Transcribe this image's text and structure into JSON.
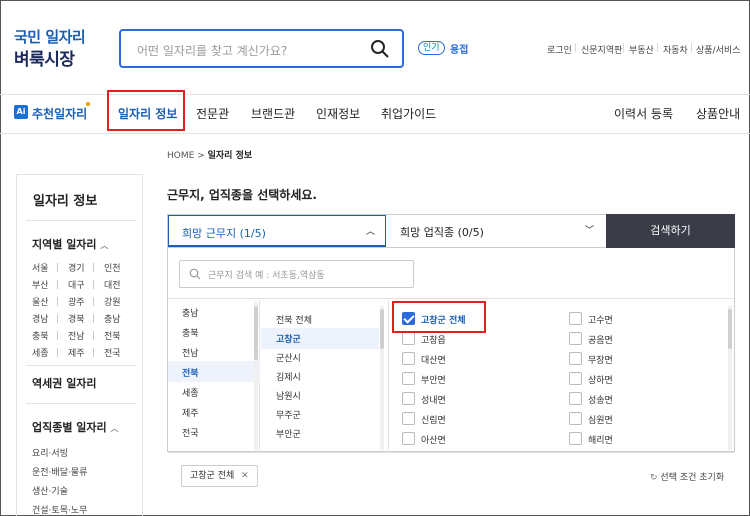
{
  "header": {
    "logo_line1": "국민 일자리",
    "logo_line2": "벼룩시장",
    "search_placeholder": "어떤 일자리를 찾고 계신가요?",
    "popular_badge": "인기",
    "popular_keyword": "용접",
    "util_links": [
      "로그인",
      "신문지역판",
      "부동산",
      "자동차",
      "상품/서비스"
    ]
  },
  "nav": {
    "ai_badge": "Ai",
    "ai_label": "추천일자리",
    "items": [
      "일자리 정보",
      "전문관",
      "브랜드관",
      "인재정보",
      "취업가이드"
    ],
    "right_items": [
      "이력서 등록",
      "상품안내"
    ]
  },
  "breadcrumb": {
    "home": "HOME",
    "sep": ">",
    "current": "일자리 정보"
  },
  "sidebar": {
    "title": "일자리 정보",
    "region_title": "지역별 일자리",
    "regions": [
      [
        "서울",
        "경기",
        "인천"
      ],
      [
        "부산",
        "대구",
        "대전"
      ],
      [
        "울산",
        "광주",
        "강원"
      ],
      [
        "경남",
        "경북",
        "충남"
      ],
      [
        "충북",
        "전남",
        "전북"
      ],
      [
        "세종",
        "제주",
        "전국"
      ]
    ],
    "station_title": "역세권 일자리",
    "jobtype_title": "업직종별 일자리",
    "jobtypes": [
      "요리·서빙",
      "운전·배달·물류",
      "생산·기술",
      "건설·토목·노무"
    ]
  },
  "main": {
    "title": "근무지, 업직종을 선택하세요.",
    "tab_location": "희망 근무지 (1/5)",
    "tab_jobtype": "희망 업직종 (0/5)",
    "search_button": "검색하기",
    "location_search_placeholder": "근무지 검색 예 : 서초동,역삼동",
    "provinces": [
      "충남",
      "충북",
      "전남",
      "전북",
      "세종",
      "제주",
      "전국"
    ],
    "selected_province": "전북",
    "cities": [
      "전북 전체",
      "고창군",
      "군산시",
      "김제시",
      "남원시",
      "무주군",
      "부안군"
    ],
    "selected_city": "고창군",
    "towns_left": [
      {
        "label": "고창군 전체",
        "checked": true
      },
      {
        "label": "고창읍",
        "checked": false
      },
      {
        "label": "대산면",
        "checked": false
      },
      {
        "label": "부안면",
        "checked": false
      },
      {
        "label": "성내면",
        "checked": false
      },
      {
        "label": "신림면",
        "checked": false
      },
      {
        "label": "아산면",
        "checked": false
      }
    ],
    "towns_right": [
      {
        "label": "고수면",
        "checked": false
      },
      {
        "label": "공음면",
        "checked": false
      },
      {
        "label": "무장면",
        "checked": false
      },
      {
        "label": "상하면",
        "checked": false
      },
      {
        "label": "성송면",
        "checked": false
      },
      {
        "label": "심원면",
        "checked": false
      },
      {
        "label": "해리면",
        "checked": false
      }
    ],
    "selected_chip": "고창군 전체",
    "chip_close": "✕",
    "reset_label": "선택 조건 초기화"
  },
  "colors": {
    "accent": "#2b6cd8",
    "highlight_box": "#e02020",
    "search_button_bg": "#3a3d48"
  }
}
